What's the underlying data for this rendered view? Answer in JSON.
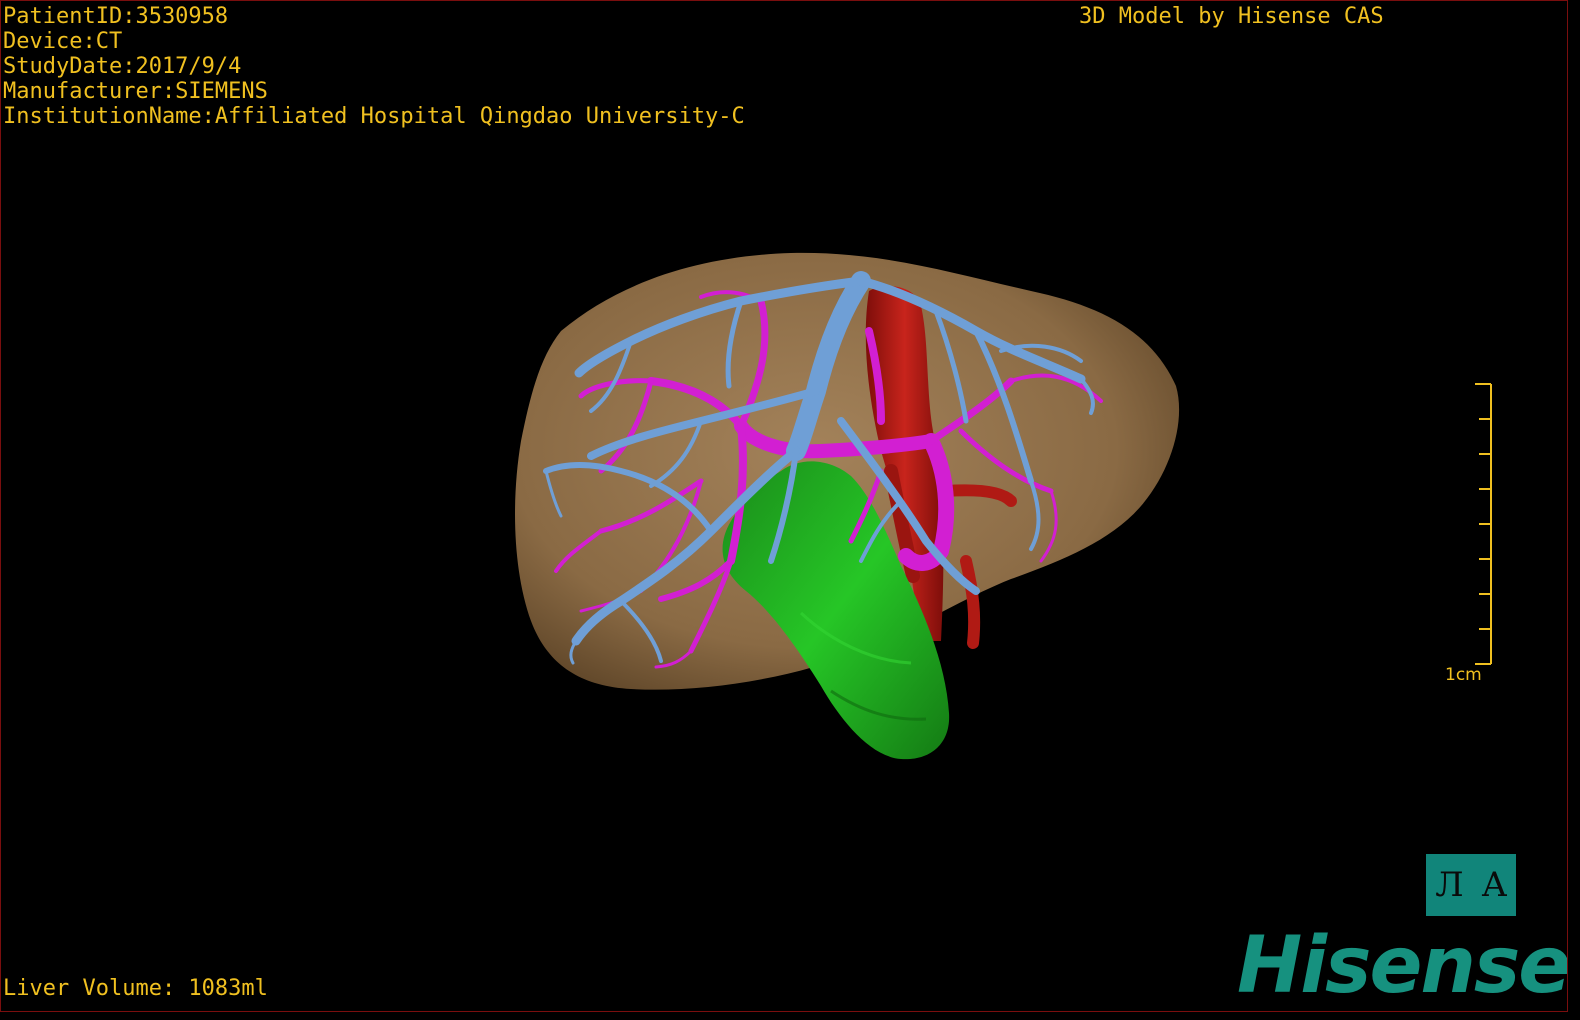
{
  "overlay": {
    "patient_id": "PatientID:3530958",
    "device": "Device:CT",
    "study_date": "StudyDate:2017/9/4",
    "manufacturer": "Manufacturer:SIEMENS",
    "institution": "InstitutionName:Affiliated Hospital Qingdao University-C",
    "model_credit": "3D Model by Hisense CAS",
    "liver_volume": "Liver Volume: 1083ml"
  },
  "scale_bar": {
    "label": "1cm"
  },
  "orientation_widget": {
    "glyph_left": "Л",
    "glyph_right": "A"
  },
  "brand": {
    "logo_text": "Hisense"
  },
  "colors": {
    "overlay_text": "#f0c020",
    "liver": "#8a6a44",
    "hepatic_vein": "#6f9fd6",
    "portal_vein": "#d21fd2",
    "artery_ivc": "#b01a14",
    "gallbladder": "#1ea81e",
    "brand": "#16917f"
  },
  "structures": [
    "liver",
    "hepatic-vein",
    "portal-vein",
    "inferior-vena-cava",
    "gallbladder"
  ]
}
